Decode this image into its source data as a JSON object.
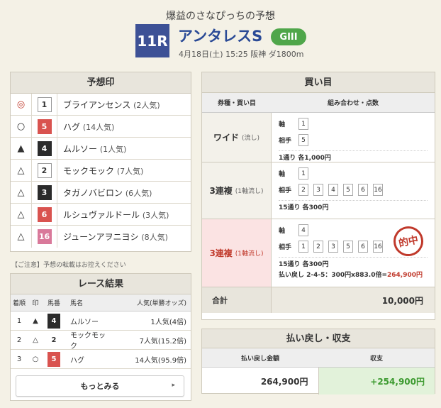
{
  "header": {
    "subtitle": "爆益のさなぴっちの予想",
    "race_number": "11R",
    "race_name": "アンタレスS",
    "grade": "GIII",
    "race_info": "4月18日(土) 15:25 阪神 ダ1800m"
  },
  "predictions": {
    "title": "予想印",
    "items": [
      {
        "mark": "◎",
        "num": "1",
        "name": "ブライアンセンス",
        "pop": "(2人気)",
        "style": "white",
        "mark_color": "red"
      },
      {
        "mark": "○",
        "num": "5",
        "name": "ハグ",
        "pop": "(14人気)",
        "style": "red",
        "mark_color": "black"
      },
      {
        "mark": "▲",
        "num": "4",
        "name": "ムルソー",
        "pop": "(1人気)",
        "style": "black",
        "mark_color": "black"
      },
      {
        "mark": "△",
        "num": "2",
        "name": "モックモック",
        "pop": "(7人気)",
        "style": "white",
        "mark_color": "black"
      },
      {
        "mark": "△",
        "num": "3",
        "name": "タガノバビロン",
        "pop": "(6人気)",
        "style": "black",
        "mark_color": "black"
      },
      {
        "mark": "△",
        "num": "6",
        "name": "ルシュヴァルドール",
        "pop": "(3人気)",
        "style": "red",
        "mark_color": "black"
      },
      {
        "mark": "△",
        "num": "16",
        "name": "ジューンアヲニヨシ",
        "pop": "(8人気)",
        "style": "pink",
        "mark_color": "black"
      }
    ]
  },
  "caution": "【ご注意】予想の転載はお控えください",
  "results": {
    "title": "レース結果",
    "headers": {
      "rank": "着順",
      "mark": "印",
      "num": "馬番",
      "name": "馬名",
      "pop": "人気(単勝オッズ)"
    },
    "rows": [
      {
        "rank": "1",
        "mark": "▲",
        "num": "4",
        "name": "ムルソー",
        "pop": "1人気(4倍)",
        "style": "black"
      },
      {
        "rank": "2",
        "mark": "△",
        "num": "2",
        "name": "モックモック",
        "pop": "7人気(15.2倍)",
        "style": "white"
      },
      {
        "rank": "3",
        "mark": "○",
        "num": "5",
        "name": "ハグ",
        "pop": "14人気(95.9倍)",
        "style": "red"
      }
    ],
    "more_label": "もっとみる"
  },
  "bets": {
    "title": "買い目",
    "col_type": "券種・買い目",
    "col_combo": "組み合わせ・点数",
    "rows": [
      {
        "type": "ワイド",
        "mode": "(流し)",
        "hit": false,
        "axis_label": "軸",
        "axis": [
          "1"
        ],
        "partner_label": "相手",
        "partners": [
          "5"
        ],
        "count": "1通り 各1,000円"
      },
      {
        "type": "3連複",
        "mode": "(1軸流し)",
        "hit": false,
        "axis_label": "軸",
        "axis": [
          "1"
        ],
        "partner_label": "相手",
        "partners": [
          "2",
          "3",
          "4",
          "5",
          "6",
          "16"
        ],
        "count": "15通り 各300円"
      },
      {
        "type": "3連複",
        "mode": "(1軸流し)",
        "hit": true,
        "axis_label": "軸",
        "axis": [
          "4"
        ],
        "partner_label": "相手",
        "partners": [
          "1",
          "2",
          "3",
          "5",
          "6",
          "16"
        ],
        "count": "15通り 各300円",
        "payout_label": "払い戻し 2-4-5：300円x883.0倍=",
        "payout_value": "264,900円",
        "stamp": "的中"
      }
    ],
    "total_label": "合計",
    "total_value": "10,000円"
  },
  "payout": {
    "title": "払い戻し・収支",
    "col_amount": "払い戻し金額",
    "col_balance": "収支",
    "amount": "264,900円",
    "balance": "+254,900円"
  },
  "colors": {
    "race_box": "#3d5196",
    "grade": "#4fa64a",
    "hit_red": "#c0392b",
    "plus_green": "#3c9a2f"
  }
}
